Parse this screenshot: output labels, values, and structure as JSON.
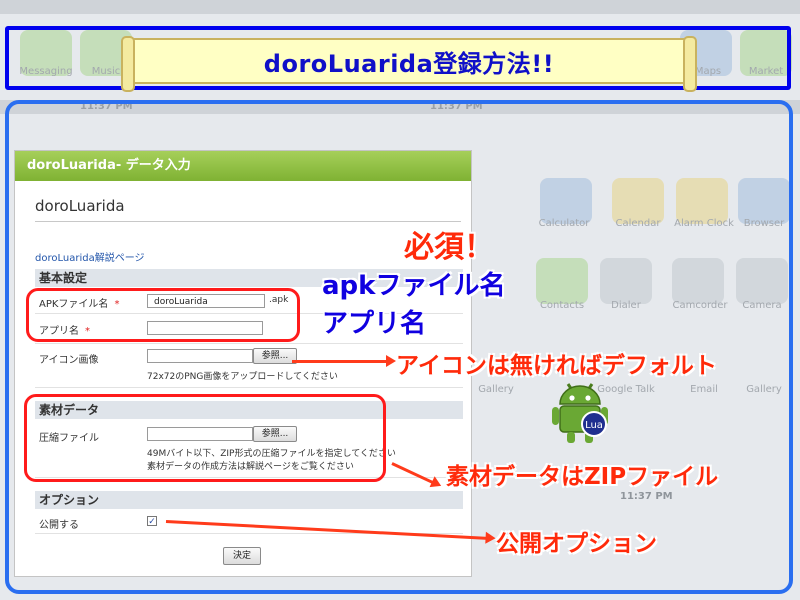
{
  "background": {
    "status_time": "11:37 PM",
    "labels_top": [
      "Messaging",
      "Music",
      "Maps",
      "Market"
    ],
    "labels_right": [
      "Calculator",
      "Calendar",
      "Alarm Clock",
      "Browser",
      "Contacts",
      "Dialer",
      "Camcorder",
      "Camera",
      "Gallery",
      "Google Talk",
      "Email",
      "Gallery"
    ]
  },
  "banner": {
    "title": "doroLuarida登録方法!!"
  },
  "form": {
    "header": "doroLuarida- データ入力",
    "app_title": "doroLuarida",
    "help_link": "doroLuarida解説ページ",
    "basic_section": "基本設定",
    "apk_label": "APKファイル名",
    "apk_value": "doroLuarida",
    "apk_suffix": ".apk",
    "app_name_label": "アプリ名",
    "app_name_value": "",
    "required_mark": "*",
    "icon_label": "アイコン画像",
    "browse_label": "参照...",
    "icon_hint": "72x72のPNG画像をアップロードしてください",
    "material_section": "素材データ",
    "zip_label": "圧縮ファイル",
    "zip_hint_1": "49Mバイト以下、ZIP形式の圧縮ファイルを指定してください",
    "zip_hint_2": "素材データの作成方法は解説ページをご覧ください",
    "option_section": "オプション",
    "publish_label": "公開する",
    "publish_checked": "✓",
    "submit_label": "決定"
  },
  "annotations": {
    "required": "必須！",
    "apk_name": "apkファイル名",
    "app_name": "アプリ名",
    "icon_default": "アイコンは無ければデフォルト",
    "material_zip": "素材データはZIPファイル",
    "publish_option": "公開オプション"
  },
  "robot_badge": "Lua",
  "colors": {
    "banner_border": "#0000ee",
    "frame_border": "#2a6ef0",
    "callout": "#ff1b1b",
    "annotation_red": "#ff2a0a",
    "annotation_blue": "#1000e0",
    "header_green": "#8cbf3f"
  }
}
